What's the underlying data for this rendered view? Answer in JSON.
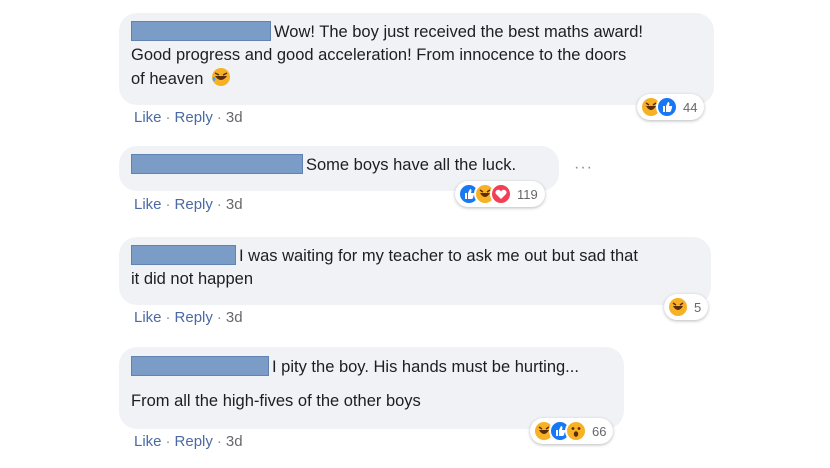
{
  "comments": [
    {
      "text_line1": "Wow! The boy just received the best maths award!",
      "text_line2": "Good progress and good acceleration! From innocence to the doors",
      "text_line3": "of heaven",
      "like": "Like",
      "reply": "Reply",
      "time": "3d",
      "reactions": [
        "haha-icon",
        "like-icon"
      ],
      "count": "44"
    },
    {
      "text_line1": "Some boys have all the luck.",
      "like": "Like",
      "reply": "Reply",
      "time": "3d",
      "reactions": [
        "like-icon",
        "haha-icon",
        "love-icon"
      ],
      "count": "119",
      "more": "···"
    },
    {
      "text_line1": "I was waiting for my teacher to ask me out but sad that",
      "text_line2": "it did not happen",
      "like": "Like",
      "reply": "Reply",
      "time": "3d",
      "reactions": [
        "haha-icon"
      ],
      "count": "5"
    },
    {
      "text_line1": "I pity the boy. His hands must be hurting...",
      "text_line2": "From all the high-fives of the other boys",
      "like": "Like",
      "reply": "Reply",
      "time": "3d",
      "reactions": [
        "haha-icon",
        "like-icon",
        "wow-icon"
      ],
      "count": "66"
    }
  ],
  "colors": {
    "bubble": "#f0f2f5",
    "redaction": "#7a9cc6",
    "link": "#4b6aa5",
    "like": "#1877f2",
    "love": "#f33e58",
    "haha": "#f7b125"
  }
}
